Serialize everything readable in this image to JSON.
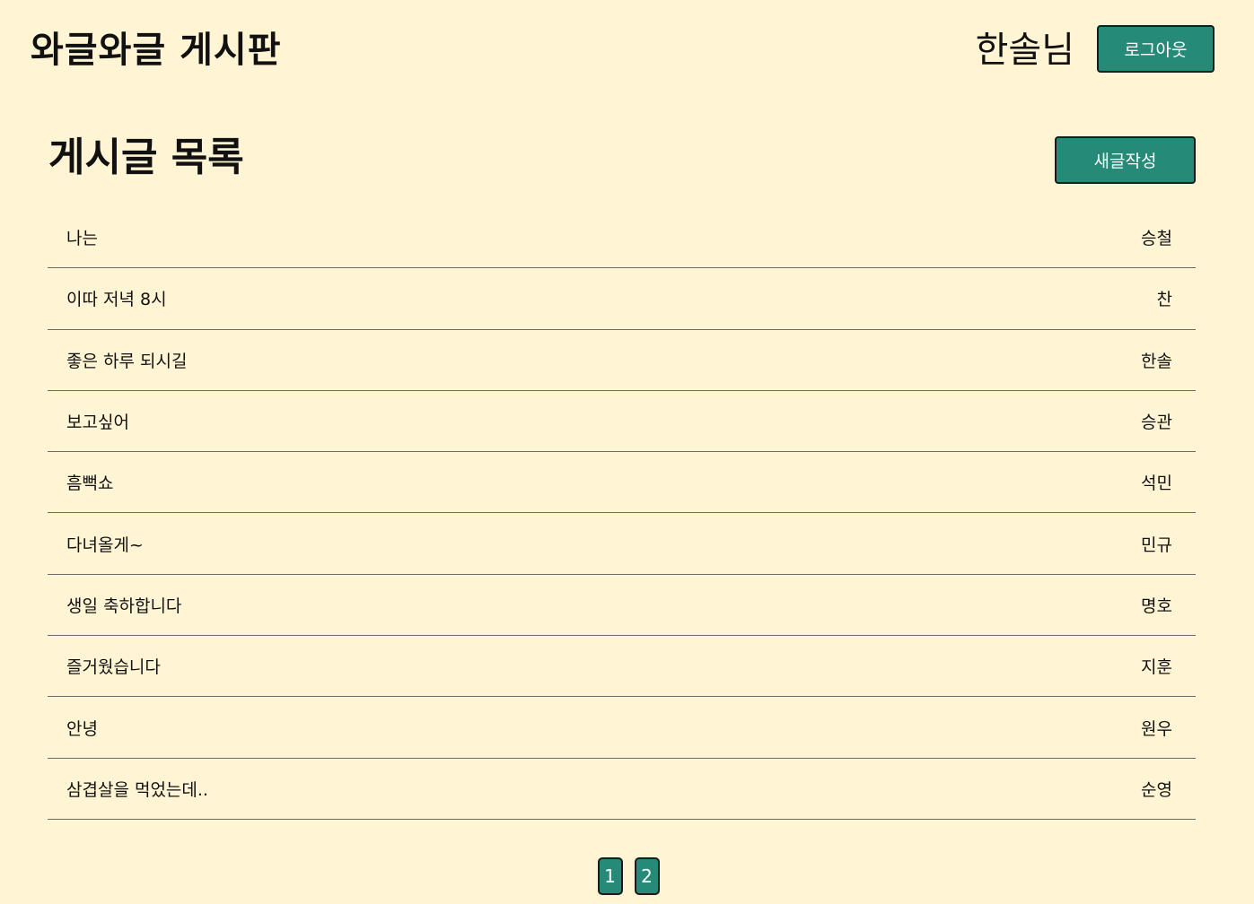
{
  "header": {
    "site_title": "와글와글 게시판",
    "user_name": "한솔님",
    "logout_label": "로그아웃"
  },
  "board": {
    "section_title": "게시글 목록",
    "write_label": "새글작성",
    "posts": [
      {
        "title": "나는",
        "author": "승철"
      },
      {
        "title": "이따 저녁 8시",
        "author": "찬"
      },
      {
        "title": "좋은 하루 되시길",
        "author": "한솔"
      },
      {
        "title": "보고싶어",
        "author": "승관"
      },
      {
        "title": "흠뻑쇼",
        "author": "석민"
      },
      {
        "title": "다녀올게~",
        "author": "민규"
      },
      {
        "title": "생일 축하합니다",
        "author": "명호"
      },
      {
        "title": "즐거웠습니다",
        "author": "지훈"
      },
      {
        "title": "안녕",
        "author": "원우"
      },
      {
        "title": "삼겹살을 먹었는데..",
        "author": "순영"
      }
    ]
  },
  "pagination": {
    "pages": [
      "1",
      "2"
    ]
  },
  "colors": {
    "background": "#fff5d4",
    "accent": "#268a78"
  }
}
